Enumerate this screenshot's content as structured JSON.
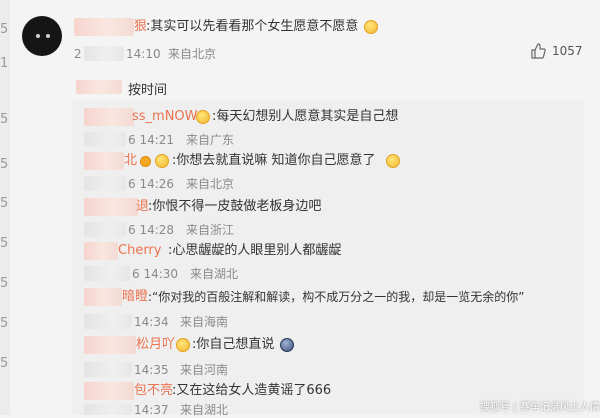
{
  "left_strip": [
    "5",
    "1",
    "5",
    "5",
    "5",
    "5",
    "5",
    "5",
    "5"
  ],
  "top_comment": {
    "username_tail": "狠",
    "text": ":其实可以先看看那个女生愿意不愿意",
    "time_prefix": "2",
    "time": "14:10",
    "location": "来自北京",
    "like_count": "1057"
  },
  "sort_label": "按时间",
  "replies": [
    {
      "name": "ss_mNOW",
      "text": ":每天幻想别人愿意其实是自己想",
      "time": "6 14:21",
      "location": "来自广东"
    },
    {
      "name": "北",
      "text": ":你想去就直说嘛 知道你自己愿意了",
      "time": "6 14:26",
      "location": "来自北京"
    },
    {
      "name": "退",
      "text": ":你恨不得一皮鼓做老板身边吧",
      "time": "6 14:28",
      "location": "来自浙江"
    },
    {
      "name": "Cherry",
      "text": ":心思龌龊的人眼里别人都龌龊",
      "time": "6 14:30",
      "location": "来自湖北"
    },
    {
      "name": "暗瞪",
      "text": ":“你对我的百般注解和解读，构不成万分之一的我，却是一览无余的你”",
      "time": "14:34",
      "location": "来自海南"
    },
    {
      "name": "松月吖",
      "text": ":你自己想直说",
      "time": "14:35",
      "location": "来自河南"
    },
    {
      "name": "包不亮",
      "text": ":又在这给女人造黄谣了666",
      "time": "14:37",
      "location": "来自湖北"
    }
  ],
  "watermark": "搜狐号 | 赛车记录风土人情",
  "colors": {
    "accent_name": "#eb7350"
  }
}
